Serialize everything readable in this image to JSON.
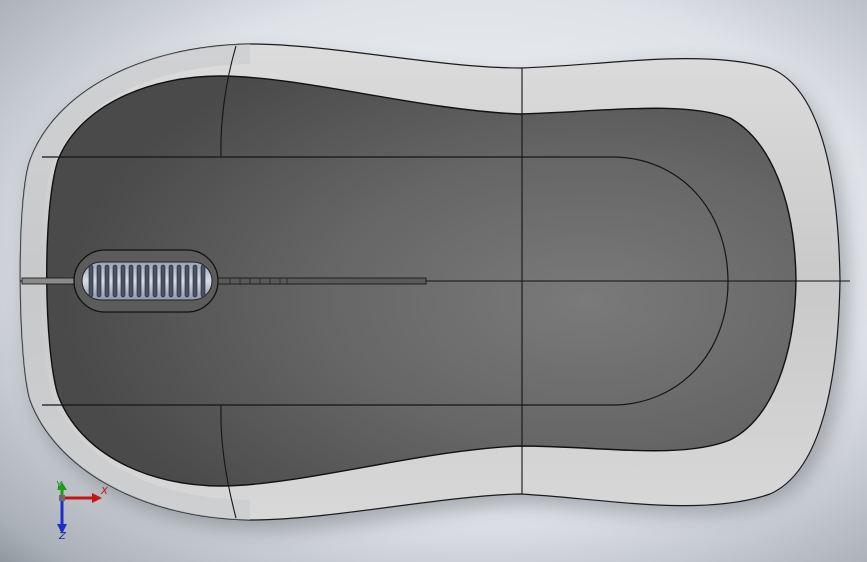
{
  "viewport": {
    "background_colors": [
      "#eef0f4",
      "#c7ccd3",
      "#7e8590"
    ],
    "model": {
      "name": "mouse-shell",
      "shell_color": "#d4d4d4",
      "top_color": "#6e6e6e",
      "edge_color": "#1a1a1a"
    }
  },
  "triad": {
    "x_label": "X",
    "y_label": "Y",
    "z_label": "Z",
    "x_color": "#c81414",
    "y_color": "#1e9a1e",
    "z_color": "#1e2ec8"
  }
}
